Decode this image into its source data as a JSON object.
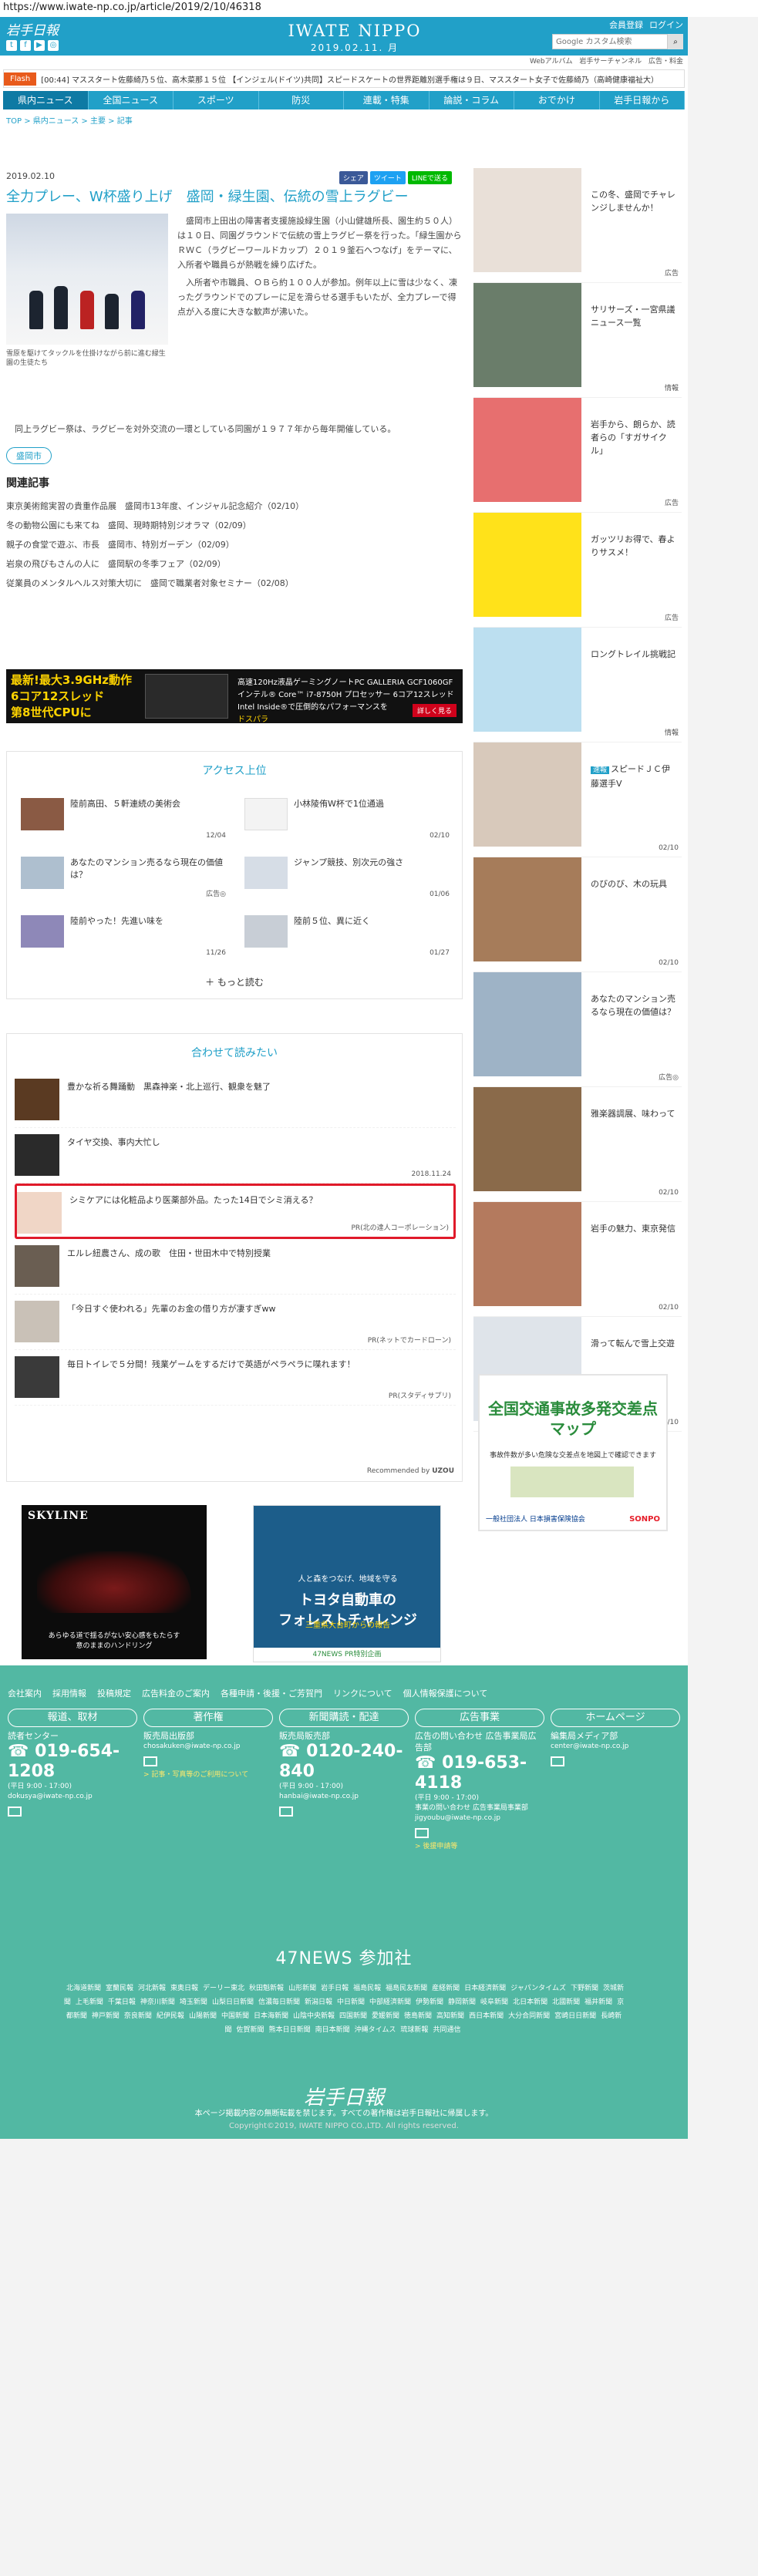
{
  "url": "https://www.iwate-np.co.jp/article/2019/2/10/46318",
  "header": {
    "logo": "岩手日報",
    "brand": "IWATE NIPPO",
    "date": "2019.02.11. 月",
    "member_links": [
      "会員登録",
      "ログイン"
    ],
    "search_placeholder": "Google カスタム検索",
    "search_button": "検索",
    "sub_links": [
      "Webアルバム",
      "岩手サーチャンネル",
      "広告・料金"
    ]
  },
  "flash": {
    "tag": "Flash",
    "text": "[00:44] マススタート佐藤綺乃５位、高木菜那１５位 【インジェル(ドイツ)共同】スピードスケートの世界距離別選手権は９日、マススタート女子で佐藤綺乃（高崎健康福祉大）"
  },
  "gnav": [
    "県内ニュース",
    "全国ニュース",
    "スポーツ",
    "防災",
    "連載・特集",
    "論説・コラム",
    "おでかけ",
    "岩手日報から"
  ],
  "breadcrumb": "TOP > 県内ニュース > 主要 > 記事",
  "article": {
    "date": "2019.02.10",
    "share": [
      "シェア",
      "ツイート",
      "LINEで送る"
    ],
    "title": "全力プレー、W杯盛り上げ　盛岡・緑生園、伝統の雪上ラグビー",
    "caption": "雪原を駆けてタックルを仕掛けながら前に進む緑生園の生徒たち",
    "body": [
      "盛岡市上田出の障害者支援施設緑生園（小山健雄所長、園生約５０人）は１０日、同園グラウンドで伝統の雪上ラグビー祭を行った。「緑生園からＲＷＣ（ラグビーワールドカップ）２０１９釜石へつなげ」をテーマに、入所者や職員らが熱戦を繰り広げた。",
      "入所者や市職員、ＯＢら約１００人が参加。例年以上に雪は少なく、凍ったグラウンドでのプレーに足を滑らせる選手もいたが、全力プレーで得点が入る度に大きな歓声が沸いた。"
    ],
    "tail": "同上ラグビー祭は、ラグビーを対外交流の一環としている同園が１９７７年から毎年開催している。",
    "tag": "盛岡市"
  },
  "related": {
    "title": "関連記事",
    "items": [
      "東京美術館実習の貴重作品展　盛岡市13年度、インジャル記念紹介（02/10）",
      "冬の動物公園にも来てね　盛岡、現時期特別ジオラマ（02/09）",
      "親子の食堂で遊ぶ、市長　盛岡市、特別ガーデン（02/09）",
      "岩泉の飛びもさんの人に　盛岡駅の冬季フェア（02/09）",
      "従業員のメンタルヘルス対策大切に　盛岡で職業者対象セミナー（02/08）"
    ]
  },
  "ad_banner": {
    "line1": "最新!最大3.9GHz動作",
    "line2": "6コア12スレッド",
    "line3": "第8世代CPUに",
    "right1": "高速120Hz液晶ゲーミングノートPC GALLERIA GCF1060GF",
    "right2": "インテル® Core™ i7-8750H プロセッサー 6コア12スレッド",
    "right3": "Intel Inside®で圧倒的なパフォーマンスを",
    "brand": "ドスパラ",
    "cta": "詳しく見る"
  },
  "access": {
    "title": "アクセス上位",
    "items": [
      {
        "title": "陸前高田、５軒連続の美術会",
        "date": "12/04"
      },
      {
        "title": "小林陵侑W杯で1位通過",
        "date": "02/10"
      },
      {
        "title": "あなたのマンション売るなら現在の価値は？",
        "date": "広告◎"
      },
      {
        "title": "ジャンプ競技、別次元の強さ",
        "date": "01/06"
      },
      {
        "title": "陸前やった！先進い味を",
        "date": "11/26"
      },
      {
        "title": "陸前５位、異に近く",
        "date": "01/27"
      }
    ],
    "more": "もっと読む"
  },
  "recommend": {
    "title": "合わせて読みたい",
    "items": [
      {
        "title": "豊かな祈る舞踊動　黒森神楽・北上巡行、観衆を魅了",
        "pr": ""
      },
      {
        "title": "タイヤ交換、事内大忙し",
        "pr": "2018.11.24"
      },
      {
        "title": "シミケアには化粧品より医薬部外品。たった14日でシミ消える？",
        "pr": "PR(北の達人コーポレーション)"
      },
      {
        "title": "エルレ紐農さん、成の歌　住田・世田木中で特別授業",
        "pr": ""
      },
      {
        "title": "「今日すぐ使われる」先輩のお金の借り方が凄すぎww",
        "pr": "PR(ネットでカードローン)"
      },
      {
        "title": "毎日トイレで５分間！残業ゲームをするだけで英語がペラペラに喋れます！",
        "pr": "PR(スタディサプリ)"
      }
    ],
    "by": "Recommended by",
    "by_brand": "UZOU"
  },
  "ad_skyline": {
    "title": "SKYLINE",
    "sub": "あらゆる道で揺るがない安心感をもたらす",
    "sub2": "意のままのハンドリング"
  },
  "ad_toyota": {
    "head": "人と森をつなげ、地域を守る",
    "big": "トヨタ自動車の",
    "big2": "フォレストチャレンジ",
    "sub": "三重県大台町からの報告",
    "bottom": "47NEWS PR特別企画"
  },
  "sidebar": [
    {
      "title": "この冬、盛岡でチャレンジしませんか！",
      "tag": "広告"
    },
    {
      "title": "サリサーズ・一宮県議ニュース一覧",
      "tag": "情報"
    },
    {
      "title": "岩手から、朗らか、読者らの「すガサイクル」",
      "tag": "広告"
    },
    {
      "title": "ガッツリお得で、春よりサスメ！",
      "tag": "広告"
    },
    {
      "title": "ロングトレイル挑戦記",
      "tag": "情報"
    },
    {
      "title": "スピードＪＣ伊藤選手V",
      "tag": "02/10",
      "sokuho": "速報"
    },
    {
      "title": "のびのび、木の玩具",
      "tag": "02/10"
    },
    {
      "title": "あなたのマンション売るなら現在の価値は？",
      "tag": "広告◎"
    },
    {
      "title": "雅楽器調展、味わって",
      "tag": "02/10"
    },
    {
      "title": "岩手の魅力、東京発信",
      "tag": "02/10"
    },
    {
      "title": "滑って転んで雪上交遊",
      "tag": "02/10"
    }
  ],
  "side_ad": {
    "title": "全国交通事故多発交差点マップ",
    "sub": "事故件数が多い危険な交差点を地図上で確認できます",
    "footer": "一般社団法人 日本損害保険協会",
    "brand": "SONPO"
  },
  "footer": {
    "links": [
      "会社案内",
      "採用情報",
      "投稿規定",
      "広告料金のご案内",
      "各種申請・後援・ご芳賀門",
      "リンクについて",
      "個人情報保護について"
    ],
    "cols": [
      {
        "head": "報道、取材",
        "l1": "読者センター",
        "tel": "019-654-1208",
        "l2": "(平日 9:00 - 17:00)",
        "mail": "dokusya@iwate-np.co.jp",
        "y": ""
      },
      {
        "head": "著作権",
        "l1": "販売局出版部",
        "tel": "",
        "l2": "chosakuken@iwate-np.co.jp",
        "mail": "",
        "y": "> 記事・写真等のご利用について"
      },
      {
        "head": "新聞購読・配達",
        "l1": "販売局販売部",
        "tel": "0120-240-840",
        "l2": "(平日 9:00 - 17:00)",
        "mail": "hanbai@iwate-np.co.jp",
        "y": ""
      },
      {
        "head": "広告事業",
        "l1": "広告の問い合わせ 広告事業局広告部",
        "tel": "019-653-4118",
        "l2": "(平日 9:00 - 17:00)",
        "mail": "事業の問い合わせ 広告事業局事業部 jigyoubu@iwate-np.co.jp",
        "y": "> 後援申請等"
      },
      {
        "head": "ホームページ",
        "l1": "編集局メディア部",
        "tel": "",
        "l2": "center@iwate-np.co.jp",
        "mail": "",
        "y": ""
      }
    ],
    "n47": "47NEWS 参加社",
    "papers": [
      "北海道新聞",
      "室蘭民報",
      "河北新報",
      "東奥日報",
      "デーリー東北",
      "秋田魁新報",
      "山形新聞",
      "岩手日報",
      "福島民報",
      "福島民友新聞",
      "産経新聞",
      "日本経済新聞",
      "ジャパンタイムズ",
      "下野新聞",
      "茨城新聞",
      "上毛新聞",
      "千葉日報",
      "神奈川新聞",
      "埼玉新聞",
      "山梨日日新聞",
      "信濃毎日新聞",
      "新潟日報",
      "中日新聞",
      "中部経済新聞",
      "伊勢新聞",
      "静岡新聞",
      "岐阜新聞",
      "北日本新聞",
      "北國新聞",
      "福井新聞",
      "京都新聞",
      "神戸新聞",
      "奈良新聞",
      "紀伊民報",
      "山陽新聞",
      "中国新聞",
      "日本海新聞",
      "山陰中央新報",
      "四国新聞",
      "愛媛新聞",
      "徳島新聞",
      "高知新聞",
      "西日本新聞",
      "大分合同新聞",
      "宮崎日日新聞",
      "長崎新聞",
      "佐賀新聞",
      "熊本日日新聞",
      "南日本新聞",
      "沖縄タイムス",
      "琉球新報",
      "共同通信"
    ],
    "logo": "岩手日報",
    "note": "本ページ掲載内容の無断転載を禁じます。すべての著作権は岩手日報社に帰属します。",
    "copyright": "Copyright©2019, IWATE NIPPO CO.,LTD. All rights reserved."
  }
}
